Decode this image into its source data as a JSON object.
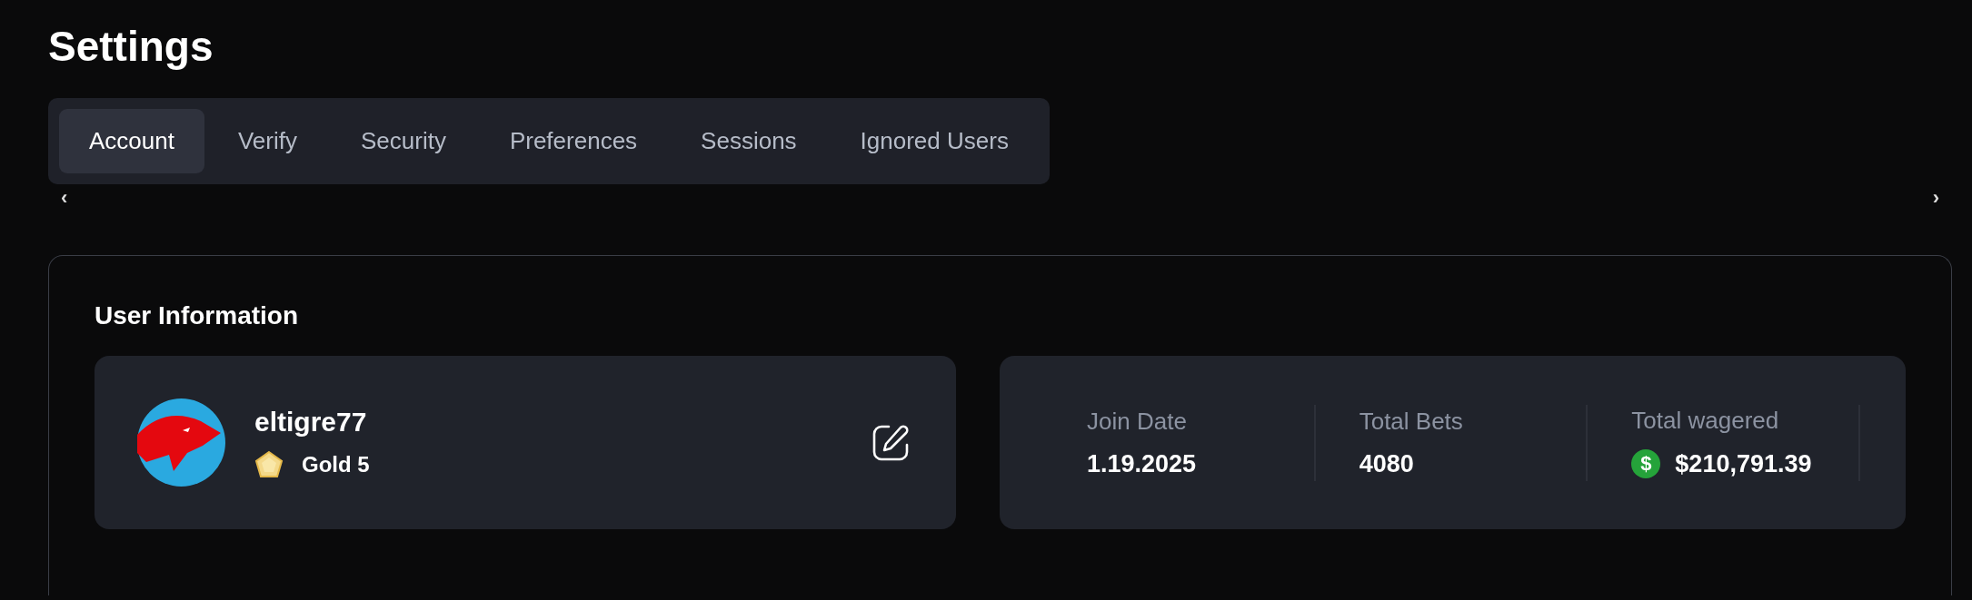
{
  "page": {
    "title": "Settings"
  },
  "tabs": [
    {
      "label": "Account",
      "selected": true
    },
    {
      "label": "Verify",
      "selected": false
    },
    {
      "label": "Security",
      "selected": false
    },
    {
      "label": "Preferences",
      "selected": false
    },
    {
      "label": "Sessions",
      "selected": false
    },
    {
      "label": "Ignored Users",
      "selected": false
    }
  ],
  "tab_scroll": {
    "left": "‹",
    "right": "›"
  },
  "user_information": {
    "heading": "User Information",
    "profile": {
      "username": "eltigre77",
      "rank": "Gold 5"
    },
    "stats": [
      {
        "kind": "plain",
        "label": "Join Date",
        "value": "1.19.2025"
      },
      {
        "kind": "plain",
        "label": "Total Bets",
        "value": "4080"
      },
      {
        "kind": "currency",
        "label": "Total wagered",
        "value": "$210,791.39",
        "currency_symbol": "$"
      }
    ]
  }
}
